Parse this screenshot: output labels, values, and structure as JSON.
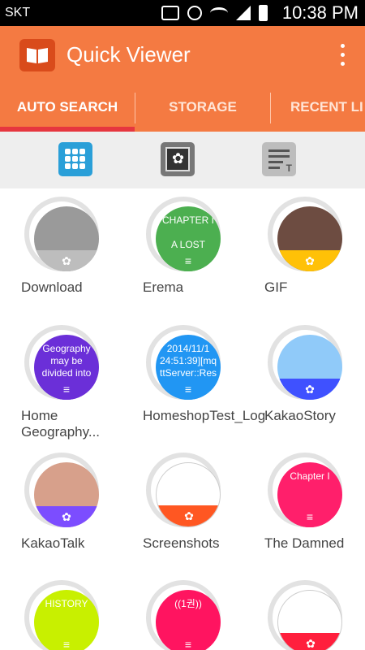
{
  "status": {
    "carrier": "SKT",
    "time": "10:38 PM"
  },
  "app": {
    "title": "Quick Viewer"
  },
  "tabs": [
    {
      "label": "AUTO SEARCH"
    },
    {
      "label": "STORAGE"
    },
    {
      "label": "RECENT LI"
    }
  ],
  "colors": {
    "accent": "#f47a42",
    "indicator": "#e6363f",
    "grid_active": "#2a9fd8"
  },
  "view_modes": [
    "grid-icon",
    "image-icon",
    "list-icon"
  ],
  "folders": [
    {
      "name": "Download",
      "text": "",
      "color": "#9a9a9a",
      "band": "#bdbdbd",
      "badge": "✿"
    },
    {
      "name": "Erema",
      "text": "CHAPTER I\n\nA LOST",
      "color": "#4caf50",
      "band": "#4caf50",
      "badge": "≡"
    },
    {
      "name": "GIF",
      "text": "",
      "color": "#6d4c41",
      "band": "#ffc107",
      "badge": "✿"
    },
    {
      "name": "Home Geography...",
      "text": "Geography\nmay be\ndivided into",
      "color": "#6b2fd8",
      "band": "#6b2fd8",
      "badge": "≡"
    },
    {
      "name": "HomeshopTest_Log",
      "text": "2014/11/1\n24:51:39][mq\nttServer::Res",
      "color": "#2196f3",
      "band": "#2196f3",
      "badge": "≡"
    },
    {
      "name": "KakaoStory",
      "text": "",
      "color": "#90caf9",
      "band": "#3f51ff",
      "badge": "✿"
    },
    {
      "name": "KakaoTalk",
      "text": "",
      "color": "#d7a08b",
      "band": "#7c4dff",
      "badge": "✿"
    },
    {
      "name": "Screenshots",
      "text": "",
      "color": "#ffffff",
      "band": "#ff5722",
      "badge": "✿"
    },
    {
      "name": "The Damned",
      "text": "Chapter I",
      "color": "#ff1f6b",
      "band": "#ff1f6b",
      "badge": "≡"
    },
    {
      "name": "",
      "text": "HISTORY",
      "color": "#c8f000",
      "band": "#c8f000",
      "badge": "≡"
    },
    {
      "name": "",
      "text": "((1권))",
      "color": "#ff1460",
      "band": "#ff1460",
      "badge": "≡"
    },
    {
      "name": "",
      "text": "",
      "color": "#ffffff",
      "band": "#ff1f3d",
      "badge": "✿"
    }
  ]
}
